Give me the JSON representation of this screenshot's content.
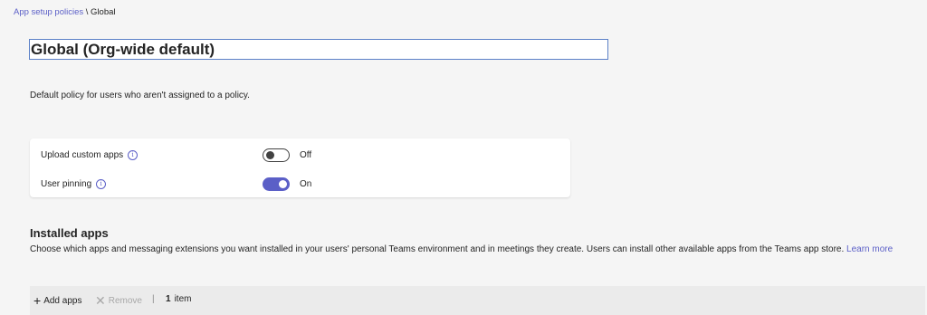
{
  "breadcrumb": {
    "parent": "App setup policies",
    "separator": " \\ ",
    "current": "Global"
  },
  "policy": {
    "name": "Global (Org-wide default)",
    "description": "Default policy for users who aren't assigned to a policy."
  },
  "settings": [
    {
      "label": "Upload custom apps",
      "state": "Off",
      "on": false
    },
    {
      "label": "User pinning",
      "state": "On",
      "on": true
    }
  ],
  "installed_apps": {
    "title": "Installed apps",
    "description": "Choose which apps and messaging extensions you want installed in your users' personal Teams environment and in meetings they create. Users can install other available apps from the Teams app store.",
    "link": "Learn more",
    "toolbar": {
      "add_label": "Add apps",
      "remove_label": "Remove",
      "separator": "|",
      "count_number": "1",
      "count_label": "item"
    }
  },
  "colors": {
    "accent": "#5b5fc7",
    "background": "#f5f5f5"
  }
}
